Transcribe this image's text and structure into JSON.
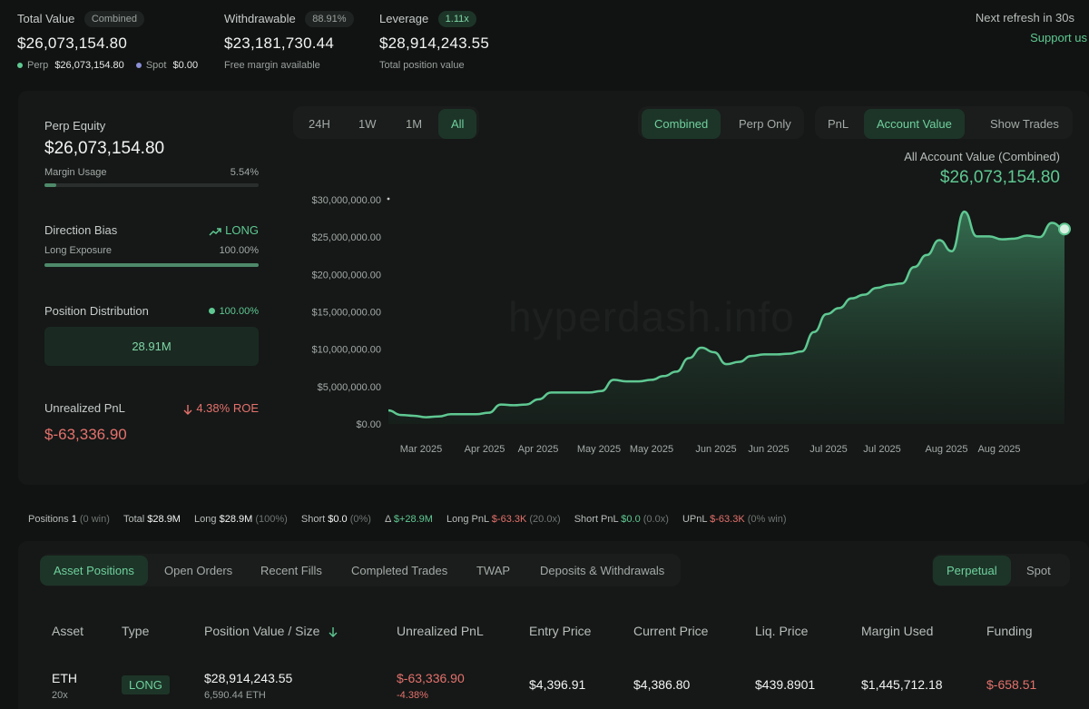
{
  "top": {
    "total_value": {
      "label": "Total Value",
      "badge": "Combined",
      "value": "$26,073,154.80",
      "perp_label": "Perp",
      "perp_value": "$26,073,154.80",
      "spot_label": "Spot",
      "spot_value": "$0.00"
    },
    "withdrawable": {
      "label": "Withdrawable",
      "badge": "88.91%",
      "value": "$23,181,730.44",
      "sub": "Free margin available"
    },
    "leverage": {
      "label": "Leverage",
      "badge": "1.11x",
      "value": "$28,914,243.55",
      "sub": "Total position value"
    },
    "refresh": "Next refresh in 30s",
    "support": "Support us"
  },
  "left": {
    "perp_equity_label": "Perp Equity",
    "perp_equity_value": "$26,073,154.80",
    "margin_usage_label": "Margin Usage",
    "margin_usage_value": "5.54%",
    "margin_usage_fraction": 0.0554,
    "direction_bias_label": "Direction Bias",
    "direction_bias_value": "LONG",
    "long_exposure_label": "Long Exposure",
    "long_exposure_value": "100.00%",
    "long_exposure_fraction": 1.0,
    "position_dist_label": "Position Distribution",
    "position_dist_value": "100.00%",
    "position_dist_box": "28.91M",
    "unrealized_label": "Unrealized PnL",
    "unrealized_roe": "4.38% ROE",
    "unrealized_value": "$-63,336.90"
  },
  "chart_controls": {
    "ranges": [
      "24H",
      "1W",
      "1M",
      "All"
    ],
    "active_range": "All",
    "modes": [
      "Combined",
      "Perp Only"
    ],
    "active_mode": "Combined",
    "metrics": [
      "PnL",
      "Account Value",
      "Show Trades"
    ],
    "active_metric": "Account Value"
  },
  "chart_header": {
    "label": "All Account Value (Combined)",
    "value": "$26,073,154.80",
    "watermark": "hyperdash.info"
  },
  "chart_data": {
    "type": "area",
    "title": "All Account Value (Combined)",
    "y_ticks": [
      "$0.00",
      "$5,000,000.00",
      "$10,000,000.00",
      "$15,000,000.00",
      "$20,000,000.00",
      "$25,000,000.00",
      "$30,000,000.00"
    ],
    "ylim": [
      0,
      30000000
    ],
    "x_ticks": [
      "Mar 2025",
      "Apr 2025",
      "Apr 2025",
      "May 2025",
      "May 2025",
      "Jun 2025",
      "Jun 2025",
      "Jul 2025",
      "Jul 2025",
      "Aug 2025",
      "Aug 2025"
    ],
    "x_tick_positions": [
      0.0,
      0.0,
      0.0,
      0.0,
      0.0,
      0.0,
      0.0,
      0.0,
      0.0,
      0.0,
      0.0
    ],
    "series": [
      {
        "values": [
          1800000,
          1200000,
          1100000,
          900000,
          1000000,
          1300000,
          1300000,
          1300000,
          1500000,
          2600000,
          2500000,
          2600000,
          3300000,
          4200000,
          4200000,
          4200000,
          4200000,
          4400000,
          5900000,
          5700000,
          5700000,
          5900000,
          6400000,
          7000000,
          8800000,
          10200000,
          9600000,
          8000000,
          8300000,
          9100000,
          9300000,
          9300000,
          9400000,
          9700000,
          12300000,
          14700000,
          15500000,
          16800000,
          17300000,
          18200000,
          18600000,
          18800000,
          21000000,
          22600000,
          24600000,
          23100000,
          28400000,
          25100000,
          25100000,
          24700000,
          24800000,
          25200000,
          25000000,
          26900000,
          26073154.8
        ]
      }
    ],
    "color": "#5fc892"
  },
  "summary": {
    "positions_label": "Positions",
    "positions_value": "1",
    "positions_win": "(0 win)",
    "total_label": "Total",
    "total_value": "$28.9M",
    "long_label": "Long",
    "long_value": "$28.9M",
    "long_pct": "(100%)",
    "short_label": "Short",
    "short_value": "$0.0",
    "short_pct": "(0%)",
    "delta_label": "Δ",
    "delta_value": "$+28.9M",
    "long_pnl_label": "Long PnL",
    "long_pnl_value": "$-63.3K",
    "long_pnl_lev": "(20.0x)",
    "short_pnl_label": "Short PnL",
    "short_pnl_value": "$0.0",
    "short_pnl_lev": "(0.0x)",
    "upnl_label": "UPnL",
    "upnl_value": "$-63.3K",
    "upnl_win": "(0% win)"
  },
  "tabs": {
    "items": [
      "Asset Positions",
      "Open Orders",
      "Recent Fills",
      "Completed Trades",
      "TWAP",
      "Deposits & Withdrawals"
    ],
    "active": "Asset Positions",
    "market": [
      "Perpetual",
      "Spot"
    ],
    "active_market": "Perpetual"
  },
  "table": {
    "headers": [
      "Asset",
      "Type",
      "Position Value / Size",
      "Unrealized PnL",
      "Entry Price",
      "Current Price",
      "Liq. Price",
      "Margin Used",
      "Funding"
    ],
    "rows": [
      {
        "asset": "ETH",
        "leverage": "20x",
        "type": "LONG",
        "position_value": "$28,914,243.55",
        "size": "6,590.44 ETH",
        "upnl": "$-63,336.90",
        "upnl_pct": "-4.38%",
        "entry": "$4,396.91",
        "current": "$4,386.80",
        "liq": "$439.8901",
        "margin": "$1,445,712.18",
        "funding": "$-658.51"
      }
    ]
  }
}
